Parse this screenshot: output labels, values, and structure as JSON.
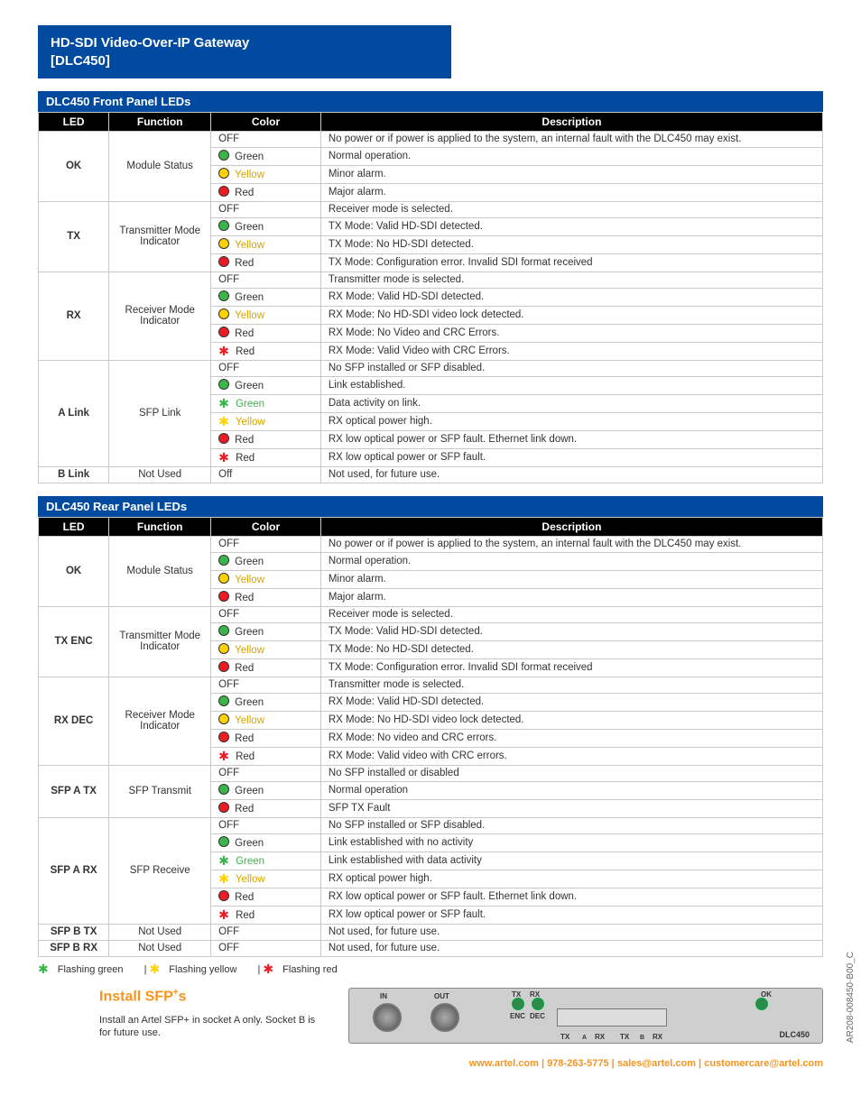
{
  "header": {
    "title": "HD-SDI Video-Over-IP Gateway",
    "model": "[DLC450]"
  },
  "th": {
    "led": "LED",
    "func": "Function",
    "color": "Color",
    "desc": "Description"
  },
  "front": {
    "title": "DLC450 Front Panel LEDs",
    "groups": [
      {
        "led": "OK",
        "func": "Module Status",
        "rows": [
          {
            "c": "OFF",
            "d": "No power or if power is applied to the system, an internal fault with the DLC450 may exist."
          },
          {
            "c": "Green",
            "t": "dot",
            "col": "g",
            "d": "Normal operation."
          },
          {
            "c": "Yellow",
            "t": "dot",
            "col": "y",
            "tx": "ytxt",
            "d": "Minor alarm."
          },
          {
            "c": "Red",
            "t": "dot",
            "col": "r",
            "d": "Major alarm."
          }
        ]
      },
      {
        "led": "TX",
        "func": "Transmitter Mode Indicator",
        "rows": [
          {
            "c": "OFF",
            "d": "Receiver mode is selected."
          },
          {
            "c": "Green",
            "t": "dot",
            "col": "g",
            "d": "TX Mode: Valid HD-SDI detected."
          },
          {
            "c": "Yellow",
            "t": "dot",
            "col": "y",
            "tx": "ytxt",
            "d": "TX Mode: No HD-SDI detected."
          },
          {
            "c": "Red",
            "t": "dot",
            "col": "r",
            "d": "TX Mode: Configuration error.  Invalid SDI format received"
          }
        ]
      },
      {
        "led": "RX",
        "func": "Receiver Mode Indicator",
        "rows": [
          {
            "c": "OFF",
            "d": "Transmitter mode is selected."
          },
          {
            "c": "Green",
            "t": "dot",
            "col": "g",
            "d": "RX Mode: Valid HD-SDI detected."
          },
          {
            "c": "Yellow",
            "t": "dot",
            "col": "y",
            "tx": "ytxt",
            "d": "RX Mode: No HD-SDI video lock detected."
          },
          {
            "c": "Red",
            "t": "dot",
            "col": "r",
            "d": "RX Mode: No Video and CRC Errors."
          },
          {
            "c": "Red",
            "t": "flash",
            "col": "r",
            "d": "RX Mode: Valid Video with CRC Errors."
          }
        ]
      },
      {
        "led": "A Link",
        "func": "SFP Link",
        "rows": [
          {
            "c": "OFF",
            "d": "No SFP installed or SFP disabled."
          },
          {
            "c": "Green",
            "t": "dot",
            "col": "g",
            "d": "Link established."
          },
          {
            "c": "Green",
            "t": "flash",
            "col": "g",
            "tx": "gtxt",
            "d": "Data activity on link."
          },
          {
            "c": "Yellow",
            "t": "flash",
            "col": "y",
            "tx": "ytxt",
            "d": "RX optical power high."
          },
          {
            "c": "Red",
            "t": "dot",
            "col": "r",
            "d": "RX low optical power or SFP fault.  Ethernet link down."
          },
          {
            "c": "Red",
            "t": "flash",
            "col": "r",
            "d": "RX low optical power or SFP fault."
          }
        ]
      },
      {
        "led": "B Link",
        "func": "Not Used",
        "rows": [
          {
            "c": "Off",
            "d": "Not used, for future use."
          }
        ]
      }
    ]
  },
  "rear": {
    "title": "DLC450 Rear Panel LEDs",
    "groups": [
      {
        "led": "OK",
        "func": "Module Status",
        "rows": [
          {
            "c": "OFF",
            "d": "No power or if power is applied to the system, an internal fault with the DLC450 may exist."
          },
          {
            "c": "Green",
            "t": "dot",
            "col": "g",
            "d": "Normal operation."
          },
          {
            "c": "Yellow",
            "t": "dot",
            "col": "y",
            "tx": "ytxt",
            "d": "Minor alarm."
          },
          {
            "c": "Red",
            "t": "dot",
            "col": "r",
            "d": "Major alarm."
          }
        ]
      },
      {
        "led": "TX ENC",
        "func": "Transmitter Mode Indicator",
        "rows": [
          {
            "c": "OFF",
            "d": "Receiver mode is selected."
          },
          {
            "c": "Green",
            "t": "dot",
            "col": "g",
            "d": "TX Mode: Valid HD-SDI detected."
          },
          {
            "c": "Yellow",
            "t": "dot",
            "col": "y",
            "tx": "ytxt",
            "d": "TX Mode: No HD-SDI detected."
          },
          {
            "c": "Red",
            "t": "dot",
            "col": "r",
            "d": "TX Mode: Configuration error.  Invalid SDI format received"
          }
        ]
      },
      {
        "led": "RX DEC",
        "func": "Receiver Mode Indicator",
        "rows": [
          {
            "c": "OFF",
            "d": "Transmitter mode is selected."
          },
          {
            "c": "Green",
            "t": "dot",
            "col": "g",
            "d": "RX Mode: Valid HD-SDI detected."
          },
          {
            "c": "Yellow",
            "t": "dot",
            "col": "y",
            "tx": "ytxt",
            "d": "RX Mode: No HD-SDI video lock detected."
          },
          {
            "c": "Red",
            "t": "dot",
            "col": "r",
            "d": "RX Mode: No video and CRC errors."
          },
          {
            "c": "Red",
            "t": "flash",
            "col": "r",
            "d": "RX Mode: Valid video with CRC errors."
          }
        ]
      },
      {
        "led": "SFP A TX",
        "func": "SFP Transmit",
        "rows": [
          {
            "c": "OFF",
            "d": "No SFP installed or disabled"
          },
          {
            "c": "Green",
            "t": "dot",
            "col": "g",
            "d": "Normal operation"
          },
          {
            "c": "Red",
            "t": "dot",
            "col": "r",
            "d": "SFP TX Fault"
          }
        ]
      },
      {
        "led": "SFP A RX",
        "func": "SFP Receive",
        "rows": [
          {
            "c": "OFF",
            "d": "No SFP installed or SFP disabled."
          },
          {
            "c": "Green",
            "t": "dot",
            "col": "g",
            "d": "Link established with no activity"
          },
          {
            "c": "Green",
            "t": "flash",
            "col": "g",
            "tx": "gtxt",
            "d": "Link established with data activity"
          },
          {
            "c": "Yellow",
            "t": "flash",
            "col": "y",
            "tx": "ytxt",
            "d": "RX optical power high."
          },
          {
            "c": "Red",
            "t": "dot",
            "col": "r",
            "d": "RX low optical power or SFP fault.  Ethernet link down."
          },
          {
            "c": "Red",
            "t": "flash",
            "col": "r",
            "d": "RX low optical power or SFP fault."
          }
        ]
      },
      {
        "led": "SFP B TX",
        "func": "Not Used",
        "rows": [
          {
            "c": "OFF",
            "d": "Not used, for future use."
          }
        ]
      },
      {
        "led": "SFP B RX",
        "func": "Not Used",
        "rows": [
          {
            "c": "OFF",
            "d": "Not used, for future use."
          }
        ]
      }
    ]
  },
  "legend": {
    "g": "Flashing green",
    "y": "Flashing yellow",
    "r": "Flashing red"
  },
  "install": {
    "title": "Install SFP",
    "plus": "+",
    "suffix": "s",
    "note": "Install an Artel SFP+ in socket A only. Socket B is for future use."
  },
  "panel": {
    "in": "IN",
    "out": "OUT",
    "tx": "TX",
    "rx": "RX",
    "enc": "ENC",
    "dec": "DEC",
    "ok": "OK",
    "model": "DLC450",
    "a": "A",
    "b": "B"
  },
  "footer": {
    "site": "www.artel.com",
    "sep": " | ",
    "phone": "978-263-5775",
    "sales": "sales@artel.com",
    "cust": "customercare@artel.com"
  },
  "doc": "AR208-008450-B00_C"
}
